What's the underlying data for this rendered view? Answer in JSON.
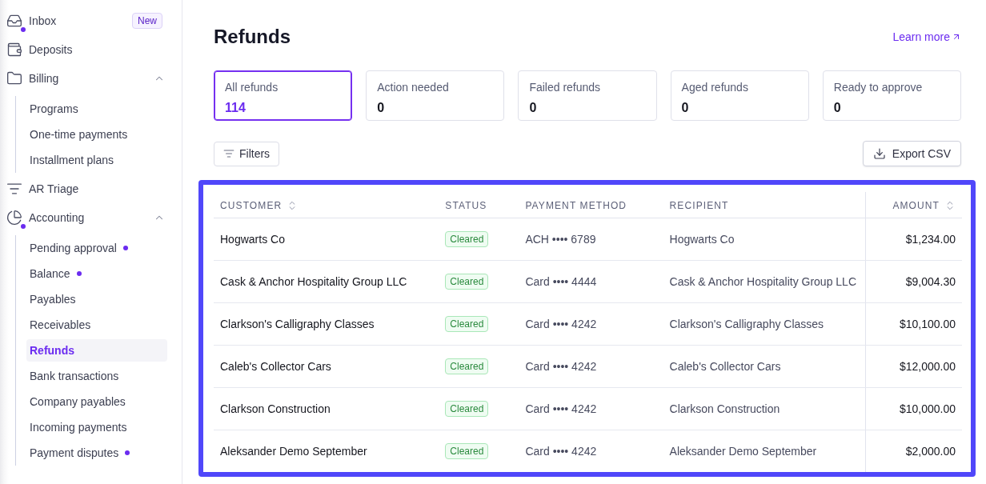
{
  "sidebar": {
    "items": [
      {
        "label": "Inbox",
        "selected": false,
        "dot": true,
        "badge": "New"
      },
      {
        "label": "Deposits",
        "selected": false,
        "dot": false
      },
      {
        "label": "Billing",
        "selected": false,
        "dot": false,
        "expanded": true,
        "children": [
          {
            "label": "Programs",
            "selected": false,
            "dot": false
          },
          {
            "label": "One-time payments",
            "selected": false,
            "dot": false
          },
          {
            "label": "Installment plans",
            "selected": false,
            "dot": false
          }
        ]
      },
      {
        "label": "AR Triage",
        "selected": false,
        "dot": false
      },
      {
        "label": "Accounting",
        "selected": false,
        "dot": true,
        "expanded": true,
        "children": [
          {
            "label": "Pending approval",
            "selected": false,
            "dot": true
          },
          {
            "label": "Balance",
            "selected": false,
            "dot": true
          },
          {
            "label": "Payables",
            "selected": false,
            "dot": false
          },
          {
            "label": "Receivables",
            "selected": false,
            "dot": false
          },
          {
            "label": "Refunds",
            "selected": true,
            "dot": false
          },
          {
            "label": "Bank transactions",
            "selected": false,
            "dot": false
          },
          {
            "label": "Company payables",
            "selected": false,
            "dot": false
          },
          {
            "label": "Incoming payments",
            "selected": false,
            "dot": false
          },
          {
            "label": "Payment disputes",
            "selected": false,
            "dot": true
          }
        ]
      }
    ]
  },
  "page": {
    "title": "Refunds",
    "learn_more": "Learn more"
  },
  "summary_cards": [
    {
      "label": "All refunds",
      "value": "114",
      "selected": true
    },
    {
      "label": "Action needed",
      "value": "0",
      "selected": false
    },
    {
      "label": "Failed refunds",
      "value": "0",
      "selected": false
    },
    {
      "label": "Aged refunds",
      "value": "0",
      "selected": false
    },
    {
      "label": "Ready to approve",
      "value": "0",
      "selected": false
    }
  ],
  "toolbar": {
    "filters": "Filters",
    "export": "Export CSV"
  },
  "table": {
    "highlighted": true,
    "columns": [
      {
        "label": "CUSTOMER",
        "sortable": true
      },
      {
        "label": "STATUS",
        "sortable": false
      },
      {
        "label": "PAYMENT METHOD",
        "sortable": false
      },
      {
        "label": "RECIPIENT",
        "sortable": false
      },
      {
        "label": "AMOUNT",
        "sortable": true
      }
    ],
    "rows": [
      {
        "customer": "Hogwarts Co",
        "status": "Cleared",
        "payment_method": "ACH •••• 6789",
        "recipient": "Hogwarts Co",
        "amount": "$1,234.00"
      },
      {
        "customer": "Cask & Anchor Hospitality Group LLC",
        "status": "Cleared",
        "payment_method": "Card •••• 4444",
        "recipient": "Cask & Anchor Hospitality Group LLC",
        "amount": "$9,004.30"
      },
      {
        "customer": "Clarkson's Calligraphy Classes",
        "status": "Cleared",
        "payment_method": "Card •••• 4242",
        "recipient": "Clarkson's Calligraphy Classes",
        "amount": "$10,100.00"
      },
      {
        "customer": "Caleb's Collector Cars",
        "status": "Cleared",
        "payment_method": "Card •••• 4242",
        "recipient": "Caleb's Collector Cars",
        "amount": "$12,000.00"
      },
      {
        "customer": "Clarkson Construction",
        "status": "Cleared",
        "payment_method": "Card •••• 4242",
        "recipient": "Clarkson Construction",
        "amount": "$10,000.00"
      },
      {
        "customer": "Aleksander Demo September",
        "status": "Cleared",
        "payment_method": "Card •••• 4242",
        "recipient": "Aleksander Demo September",
        "amount": "$2,000.00"
      }
    ]
  }
}
